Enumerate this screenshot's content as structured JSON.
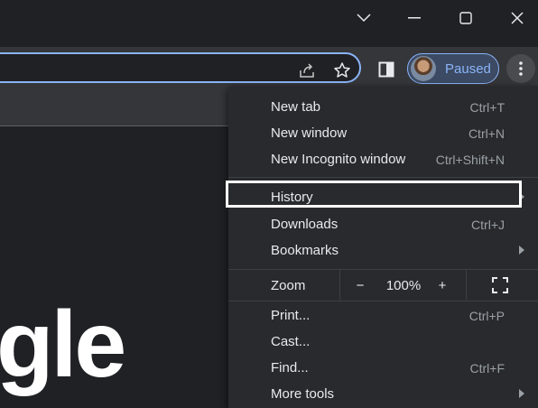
{
  "window_controls": {
    "tab_search": "chevron-down-icon",
    "minimize": "minimize-icon",
    "maximize": "maximize-icon",
    "close": "close-icon"
  },
  "toolbar": {
    "share_icon": "share-icon",
    "bookmark_icon": "star-icon",
    "side_panel_icon": "side-panel-icon",
    "profile": {
      "status": "Paused"
    },
    "menu_icon": "three-dot-menu-icon"
  },
  "page": {
    "logo_fragment": "gle"
  },
  "menu": {
    "groups": [
      [
        {
          "label": "New tab",
          "shortcut": "Ctrl+T"
        },
        {
          "label": "New window",
          "shortcut": "Ctrl+N"
        },
        {
          "label": "New Incognito window",
          "shortcut": "Ctrl+Shift+N"
        }
      ],
      [
        {
          "label": "History",
          "shortcut": "",
          "submenu": true,
          "highlighted": true
        },
        {
          "label": "Downloads",
          "shortcut": "Ctrl+J"
        },
        {
          "label": "Bookmarks",
          "shortcut": "",
          "submenu": true
        }
      ]
    ],
    "zoom": {
      "label": "Zoom",
      "minus": "−",
      "value": "100%",
      "plus": "+",
      "fullscreen_icon": "fullscreen-icon"
    },
    "tail": [
      {
        "label": "Print...",
        "shortcut": "Ctrl+P"
      },
      {
        "label": "Cast...",
        "shortcut": ""
      },
      {
        "label": "Find...",
        "shortcut": "Ctrl+F"
      },
      {
        "label": "More tools",
        "shortcut": "",
        "submenu": true
      }
    ]
  },
  "colors": {
    "accent": "#8ab4f8",
    "menu_bg": "#292a2d",
    "toolbar_bg": "#35363a",
    "titlebar_bg": "#202124"
  }
}
